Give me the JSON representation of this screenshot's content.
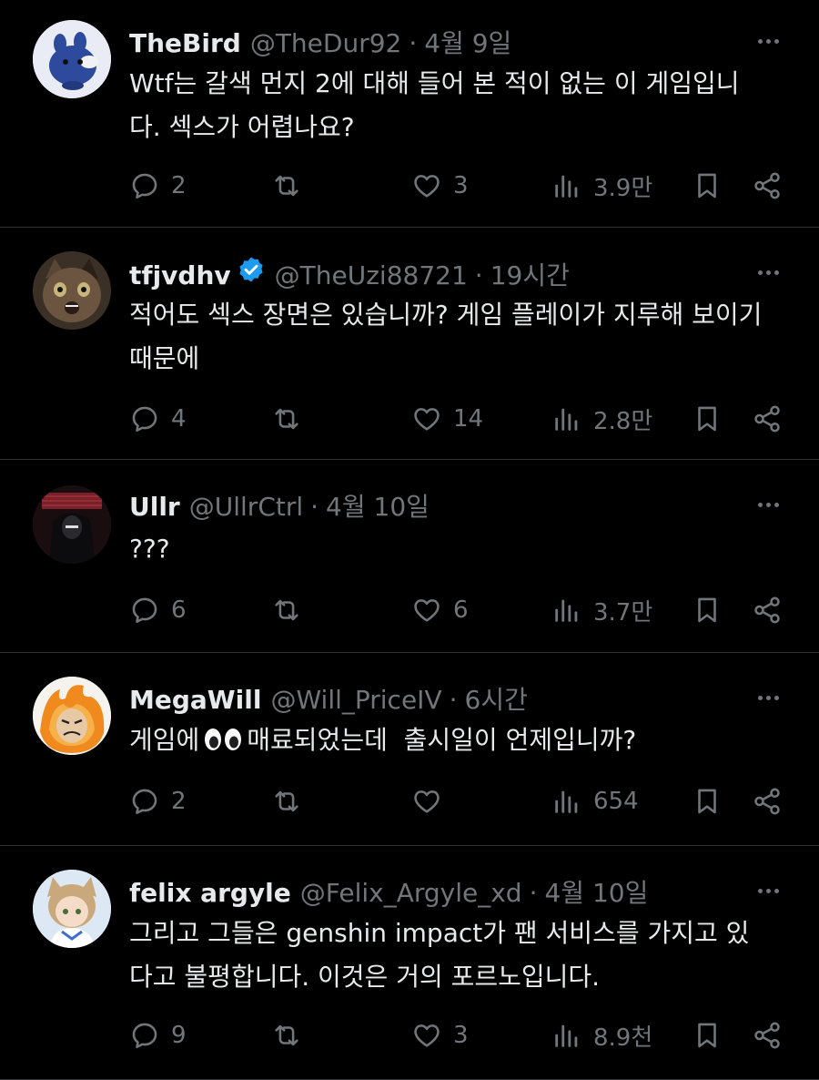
{
  "colors": {
    "background": "#000000",
    "text": "#e7e9ea",
    "muted": "#71767b",
    "divider": "#2f3336",
    "verified": "#1d9bf0"
  },
  "tweets": [
    {
      "name": "TheBird",
      "handle": "@TheDur92",
      "time": "4월 9일",
      "verified": false,
      "text": "Wtf는 갈색 먼지 2에 대해 들어 본 적이 없는 이 게임입니\n다. 섹스가 어렵나요?",
      "replies": "2",
      "retweets": "",
      "likes": "3",
      "views": "3.9만",
      "avatar_icon": "blue-bird-plush-avatar"
    },
    {
      "name": "tfjvdhv",
      "handle": "@TheUzi88721",
      "time": "19시간",
      "verified": true,
      "text": "적어도 섹스 장면은 있습니까? 게임 플레이가 지루해 보이기\n때문에",
      "replies": "4",
      "retweets": "",
      "likes": "14",
      "views": "2.8만",
      "avatar_icon": "cat-avatar"
    },
    {
      "name": "Ullr",
      "handle": "@UllrCtrl",
      "time": "4월 10일",
      "verified": false,
      "text": "???",
      "replies": "6",
      "retweets": "",
      "likes": "6",
      "views": "3.7만",
      "avatar_icon": "hooded-figure-avatar"
    },
    {
      "name": "MegaWill",
      "handle": "@Will_PriceIV",
      "time": "6시간",
      "verified": false,
      "text_before": "게임에",
      "text_after": "매료되었는데  출시일이 언제입니까?",
      "replies": "2",
      "retweets": "",
      "likes": "",
      "views": "654",
      "avatar_icon": "flame-hero-avatar",
      "emoji_icon": "eyes-emoji"
    },
    {
      "name": "felix argyle",
      "handle": "@Felix_Argyle_xd",
      "time": "4월 10일",
      "verified": false,
      "text": "그리고 그들은 genshin impact가 팬 서비스를 가지고 있\n다고 불평합니다. 이것은 거의 포르노입니다.",
      "replies": "9",
      "retweets": "",
      "likes": "3",
      "views": "8.9천",
      "avatar_icon": "anime-catgirl-avatar"
    }
  ],
  "separator": "·"
}
